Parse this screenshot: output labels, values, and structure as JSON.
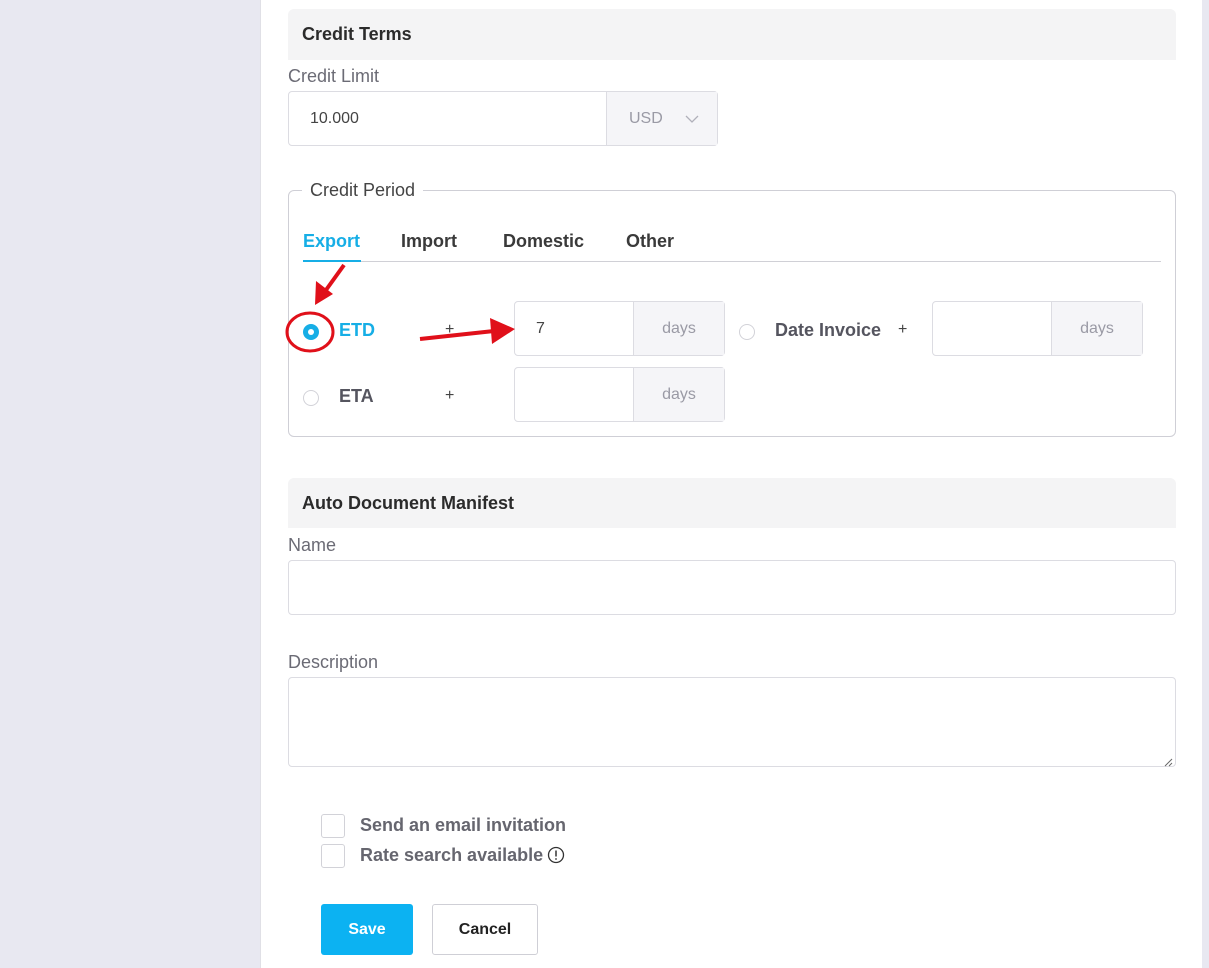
{
  "credit_terms": {
    "header": "Credit Terms",
    "credit_limit_label": "Credit Limit",
    "credit_limit_value": "10.000",
    "currency": "USD",
    "credit_period": {
      "legend": "Credit Period",
      "tabs": [
        {
          "label": "Export",
          "active": true
        },
        {
          "label": "Import",
          "active": false
        },
        {
          "label": "Domestic",
          "active": false
        },
        {
          "label": "Other",
          "active": false
        }
      ],
      "etd": {
        "label": "ETD",
        "checked": true,
        "plus": "+",
        "value": "7",
        "unit": "days"
      },
      "eta": {
        "label": "ETA",
        "checked": false,
        "plus": "+",
        "value": "",
        "unit": "days"
      },
      "date_invoice": {
        "label": "Date Invoice",
        "checked": false,
        "plus": "+",
        "value": "",
        "unit": "days"
      }
    }
  },
  "auto_document_manifest": {
    "header": "Auto Document Manifest",
    "name_label": "Name",
    "name_value": "",
    "description_label": "Description",
    "description_value": ""
  },
  "options": {
    "send_email_label": "Send an email invitation",
    "rate_search_label": "Rate search available"
  },
  "actions": {
    "save_label": "Save",
    "cancel_label": "Cancel"
  },
  "colors": {
    "accent": "#16aee6",
    "save_button": "#0cb2f2",
    "annotation_red": "#e0101a",
    "page_background": "#e8e8f1"
  }
}
